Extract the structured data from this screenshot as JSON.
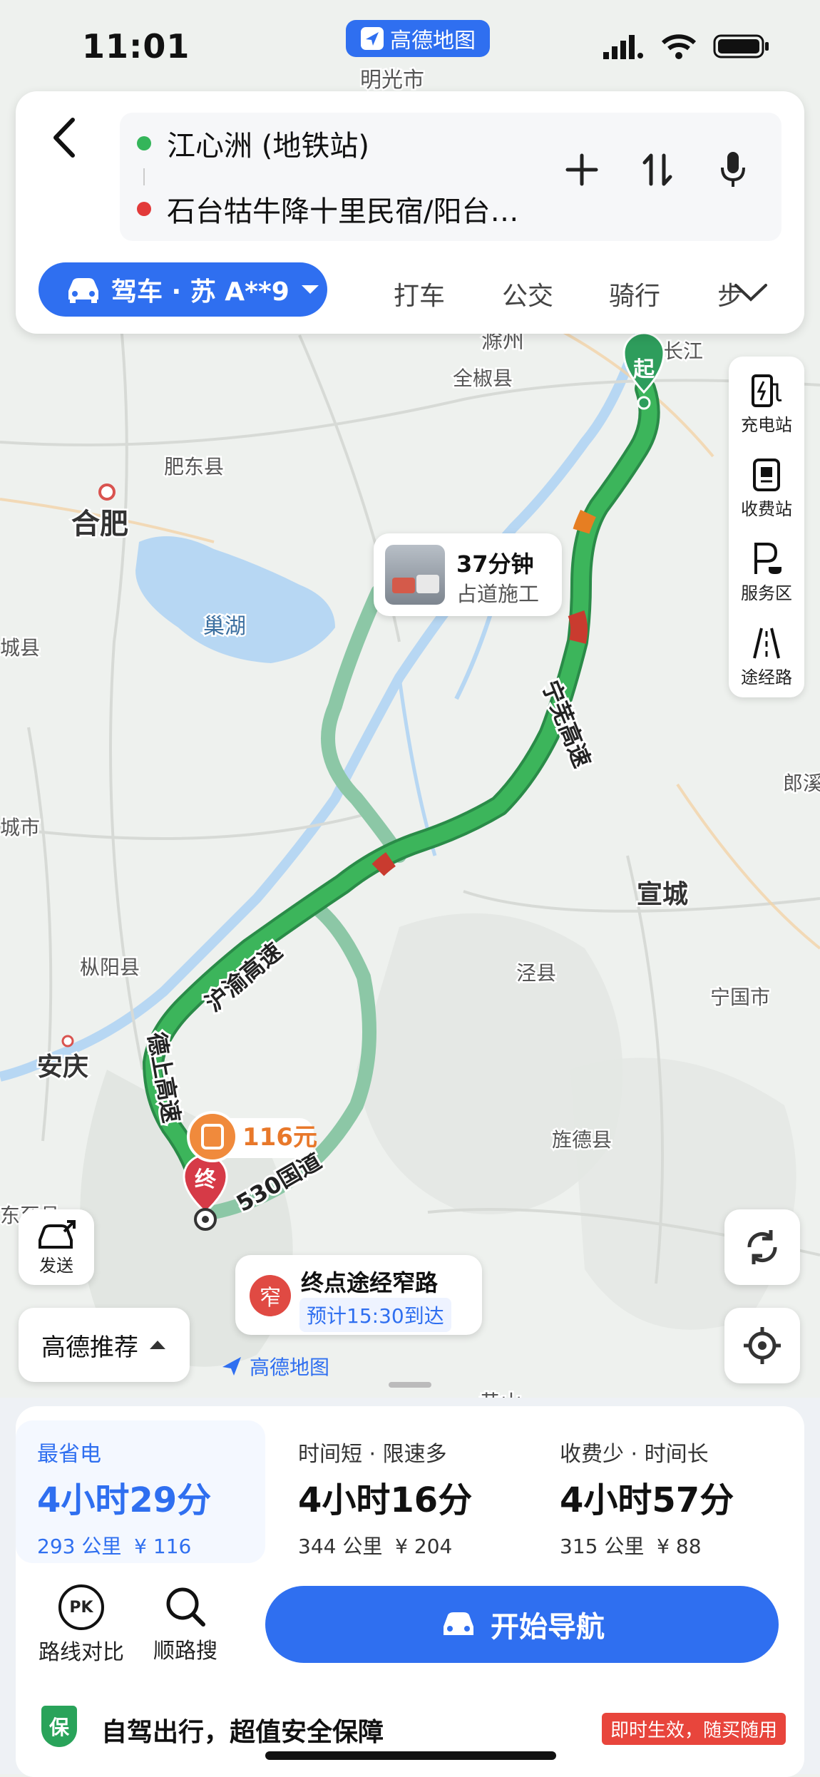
{
  "status_bar": {
    "time": "11:01",
    "app_name": "高德地图"
  },
  "route": {
    "origin": "江心洲 (地铁站)",
    "destination": "石台牯牛降十里民宿/阳台…",
    "origin_color": "#34b55a",
    "destination_color": "#e23a3a"
  },
  "modes": {
    "active": "驾车 · 苏 A**9",
    "items": [
      "打车",
      "公交",
      "骑行",
      "步"
    ]
  },
  "side_tools": [
    "充电站",
    "收费站",
    "服务区",
    "途经路"
  ],
  "map": {
    "labels": {
      "mingguang": "明光市",
      "chuzhou": "滁州",
      "quanjiao": "全椒县",
      "changjiang": "长江",
      "feidong": "肥东县",
      "hefei": "合肥",
      "chaohu": "巢湖",
      "chengxian": "城县",
      "xuancheng": "宣城",
      "jingxian": "泾县",
      "ningguo": "宁国市",
      "zongyang": "枞阳县",
      "anqing": "安庆",
      "jingde": "旌德县",
      "langxi": "郎溪",
      "chengshi": "城市",
      "dongzhi": "东至县",
      "huangshan": "黄山",
      "logo": "高德地图"
    },
    "highways": {
      "ningwu": "宁芜高速",
      "huyu": "沪渝高速",
      "deshang": "德上高速",
      "guodao": "530国道"
    },
    "start_marker": "起",
    "end_marker": "终",
    "traffic_callout": {
      "duration": "37分钟",
      "reason": "占道施工"
    },
    "toll_tag": "116元",
    "narrow_callout": {
      "badge": "窄",
      "title": "终点途经窄路",
      "eta": "预计15:30到达"
    },
    "send_label": "发送",
    "recommend_label": "高德推荐",
    "route_color": "#3cb55b",
    "alt_route_color": "#8cc7a6",
    "congestion_color": "#c93b2f"
  },
  "options": [
    {
      "label": "最省电",
      "duration": "4小时29分",
      "distance": "293 公里",
      "cost": "¥ 116"
    },
    {
      "label": "时间短 · 限速多",
      "duration": "4小时16分",
      "distance": "344 公里",
      "cost": "¥ 204"
    },
    {
      "label": "收费少 · 时间长",
      "duration": "4小时57分",
      "distance": "315 公里",
      "cost": "¥ 88"
    }
  ],
  "actions": {
    "compare": "路线对比",
    "search": "顺路搜",
    "navigate": "开始导航",
    "pk": "PK"
  },
  "insurance": {
    "badge": "保",
    "text": "自驾出行，超值安全保障",
    "tag": "即时生效，随买随用"
  }
}
